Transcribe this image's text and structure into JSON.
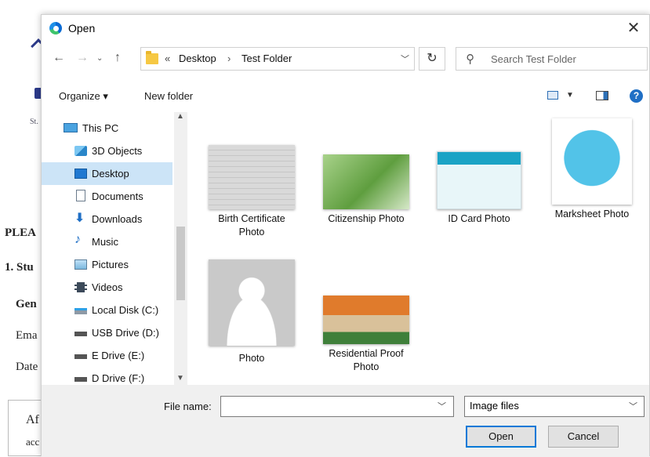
{
  "background_page": {
    "lines": [
      "St.",
      "PLEA",
      "1. Stu",
      "Gen",
      "Ema",
      "Date",
      "Af",
      "acc"
    ]
  },
  "dialog": {
    "title": "Open",
    "close_glyph": "✕"
  },
  "address": {
    "overflow": "«",
    "crumbs": [
      "Desktop",
      "Test Folder"
    ],
    "separator": "›",
    "search_placeholder": "Search Test Folder"
  },
  "toolbar": {
    "organize_label": "Organize ▾",
    "new_folder_label": "New folder",
    "help_glyph": "?"
  },
  "nav_pane": {
    "items": [
      {
        "label": "This PC",
        "icon": "computer-icon"
      },
      {
        "label": "3D Objects",
        "icon": "cube-icon"
      },
      {
        "label": "Desktop",
        "icon": "desktop-icon",
        "selected": true
      },
      {
        "label": "Documents",
        "icon": "document-icon"
      },
      {
        "label": "Downloads",
        "icon": "download-icon"
      },
      {
        "label": "Music",
        "icon": "music-icon"
      },
      {
        "label": "Pictures",
        "icon": "pictures-icon"
      },
      {
        "label": "Videos",
        "icon": "video-icon"
      },
      {
        "label": "Local Disk (C:)",
        "icon": "drive-icon"
      },
      {
        "label": "USB Drive (D:)",
        "icon": "drive-icon"
      },
      {
        "label": "E Drive (E:)",
        "icon": "drive-icon"
      },
      {
        "label": "D Drive (F:)",
        "icon": "drive-icon"
      }
    ]
  },
  "files": [
    {
      "name": "Birth Certificate Photo"
    },
    {
      "name": "Citizenship Photo"
    },
    {
      "name": "ID Card Photo"
    },
    {
      "name": "Marksheet Photo"
    },
    {
      "name": "Photo"
    },
    {
      "name": "Residential Proof Photo"
    }
  ],
  "footer": {
    "file_name_label": "File name:",
    "file_name_value": "",
    "file_type": "Image files",
    "open_label": "Open",
    "cancel_label": "Cancel"
  },
  "colors": {
    "selection": "#cce4f7",
    "accent": "#0078d7",
    "footer_bg": "#f0f0f0"
  }
}
